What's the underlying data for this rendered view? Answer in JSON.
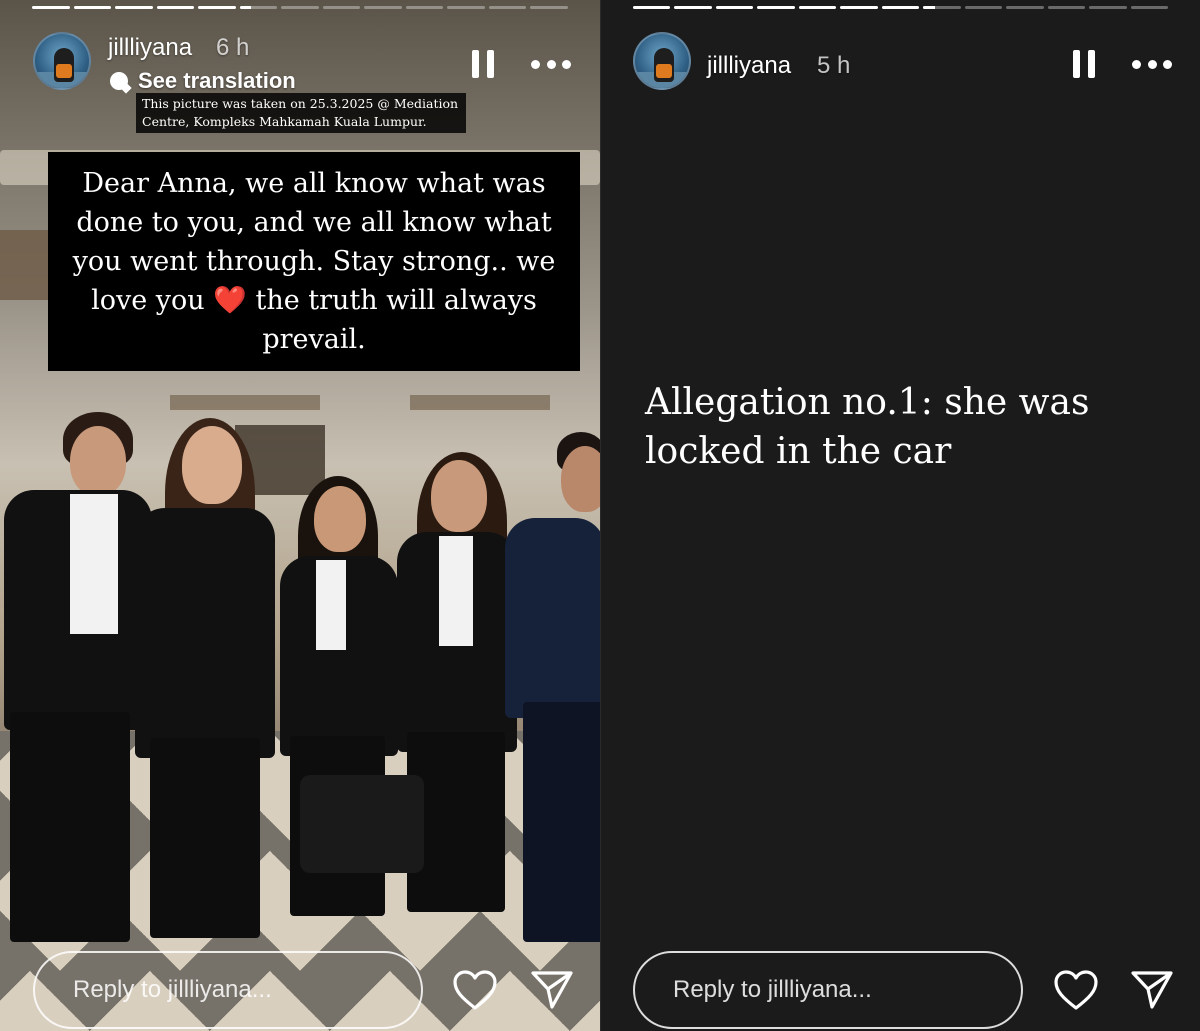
{
  "left_story": {
    "username": "jillliyana",
    "time": "6 h",
    "translation_label": "See translation",
    "small_caption": "This picture was taken on 25.3.2025 @ Mediation Centre, Kompleks Mahkamah Kuala Lumpur.",
    "main_caption_before_heart": "Dear Anna, we all know what was done to you, and we all know what you went through. Stay strong.. we love you",
    "heart_emoji": "❤️",
    "main_caption_after_heart": "the truth will always prevail.",
    "reply_placeholder": "Reply to jillliyana...",
    "progress": [
      1,
      1,
      1,
      1,
      1,
      0.3,
      0,
      0,
      0,
      0,
      0,
      0,
      0
    ]
  },
  "right_story": {
    "username": "jillliyana",
    "time": "5 h",
    "text": "Allegation no.1: she was locked in the car",
    "reply_placeholder": "Reply to jillliyana...",
    "progress": [
      1,
      1,
      1,
      1,
      1,
      1,
      1,
      0.3,
      0,
      0,
      0,
      0,
      0
    ]
  },
  "icons": {
    "pause": "pause-icon",
    "more": "more-icon",
    "like": "heart-icon",
    "share": "send-icon",
    "translate": "speech-bubble-icon"
  }
}
